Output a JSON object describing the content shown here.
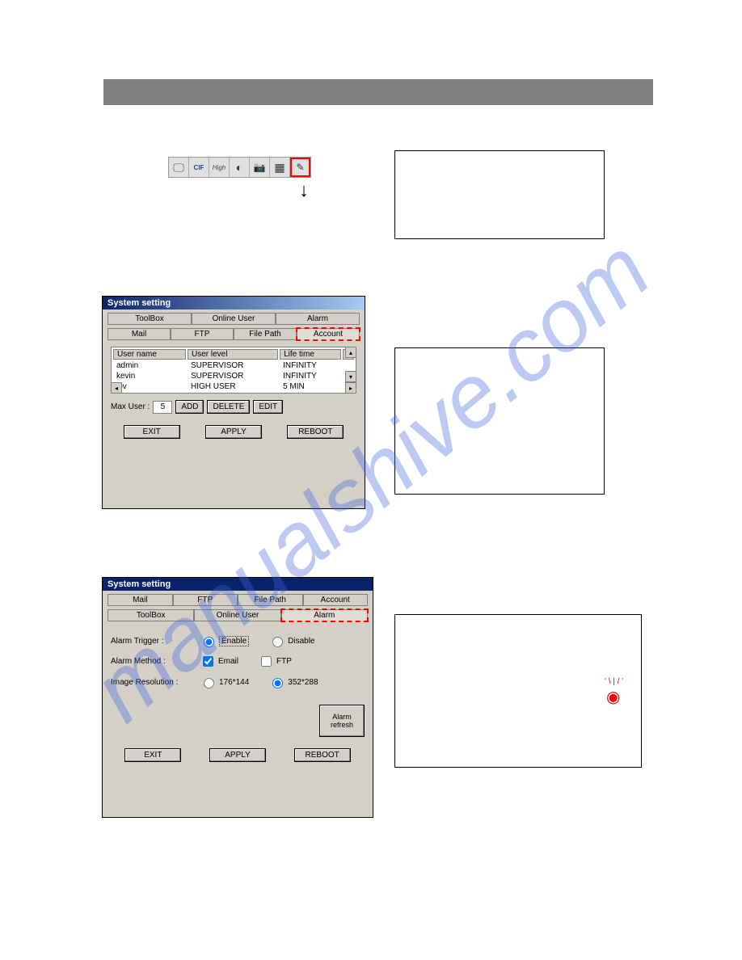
{
  "toolbar": {
    "icons": [
      "monitor-icon",
      "cif-icon",
      "high-icon",
      "contrast-icon",
      "camera-icon",
      "film-icon",
      "settings-icon"
    ]
  },
  "dialog1": {
    "title": "System setting",
    "tabsRow1": [
      "ToolBox",
      "Online User",
      "Alarm"
    ],
    "tabsRow2": [
      "Mail",
      "FTP",
      "File Path",
      "Account"
    ],
    "activeTab": "Account",
    "table": {
      "headers": [
        "User name",
        "User level",
        "Life time"
      ],
      "rows": [
        {
          "user": "admin",
          "level": "SUPERVISOR",
          "life": "INFINITY"
        },
        {
          "user": "kevin",
          "level": "SUPERVISOR",
          "life": "INFINITY"
        },
        {
          "user": "lov",
          "level": "HIGH USER",
          "life": "5 MIN"
        }
      ]
    },
    "maxUserLabel": "Max User :",
    "maxUserValue": "5",
    "buttons": {
      "add": "ADD",
      "delete": "DELETE",
      "edit": "EDIT"
    },
    "footer": {
      "exit": "EXIT",
      "apply": "APPLY",
      "reboot": "REBOOT"
    }
  },
  "dialog2": {
    "title": "System setting",
    "tabsRow1": [
      "Mail",
      "FTP",
      "File Path",
      "Account"
    ],
    "tabsRow2": [
      "ToolBox",
      "Online User",
      "Alarm"
    ],
    "activeTab": "Alarm",
    "fields": {
      "triggerLabel": "Alarm Trigger :",
      "triggerOptions": {
        "enable": "Enable",
        "disable": "Disable"
      },
      "triggerValue": "Enable",
      "methodLabel": "Alarm Method :",
      "methodOptions": {
        "email": "Email",
        "ftp": "FTP"
      },
      "methodValueEmail": true,
      "methodValueFtp": false,
      "resLabel": "Image Resolution :",
      "resOptions": {
        "a": "176*144",
        "b": "352*288"
      },
      "resValue": "352*288",
      "refreshBtn": "Alarm\nrefresh"
    },
    "footer": {
      "exit": "EXIT",
      "apply": "APPLY",
      "reboot": "REBOOT"
    }
  },
  "watermark": "manualshive.com"
}
